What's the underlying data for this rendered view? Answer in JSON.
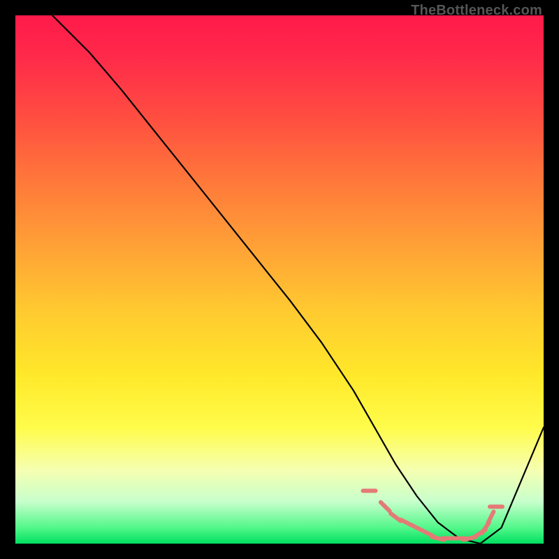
{
  "attribution": "TheBottleneck.com",
  "chart_data": {
    "type": "line",
    "title": "",
    "xlabel": "",
    "ylabel": "",
    "xlim": [
      0,
      100
    ],
    "ylim": [
      0,
      100
    ],
    "grid": false,
    "legend": false,
    "series": [
      {
        "name": "curve",
        "color": "#000000",
        "x": [
          7,
          10,
          14,
          20,
          28,
          36,
          44,
          52,
          58,
          64,
          68,
          72,
          76,
          80,
          84,
          88,
          92,
          100
        ],
        "y": [
          100,
          97,
          93,
          86,
          76,
          66,
          56,
          46,
          38,
          29,
          22,
          15,
          9,
          4,
          1,
          0,
          3,
          22
        ]
      }
    ],
    "markers": {
      "name": "trough-markers",
      "color": "#e47a76",
      "x": [
        67,
        70,
        72,
        74,
        76,
        78,
        80,
        82,
        84,
        86,
        88,
        89,
        90,
        91
      ],
      "y": [
        10,
        7,
        5,
        4,
        3,
        2,
        1,
        1,
        1,
        1,
        2,
        3,
        5,
        7
      ]
    },
    "background_gradient": {
      "stops": [
        {
          "pos": 0,
          "color": "#ff1a4a"
        },
        {
          "pos": 20,
          "color": "#ff5040"
        },
        {
          "pos": 44,
          "color": "#ffa236"
        },
        {
          "pos": 68,
          "color": "#ffe82a"
        },
        {
          "pos": 86,
          "color": "#f6ffb0"
        },
        {
          "pos": 97,
          "color": "#52f78a"
        },
        {
          "pos": 100,
          "color": "#00e060"
        }
      ]
    }
  }
}
